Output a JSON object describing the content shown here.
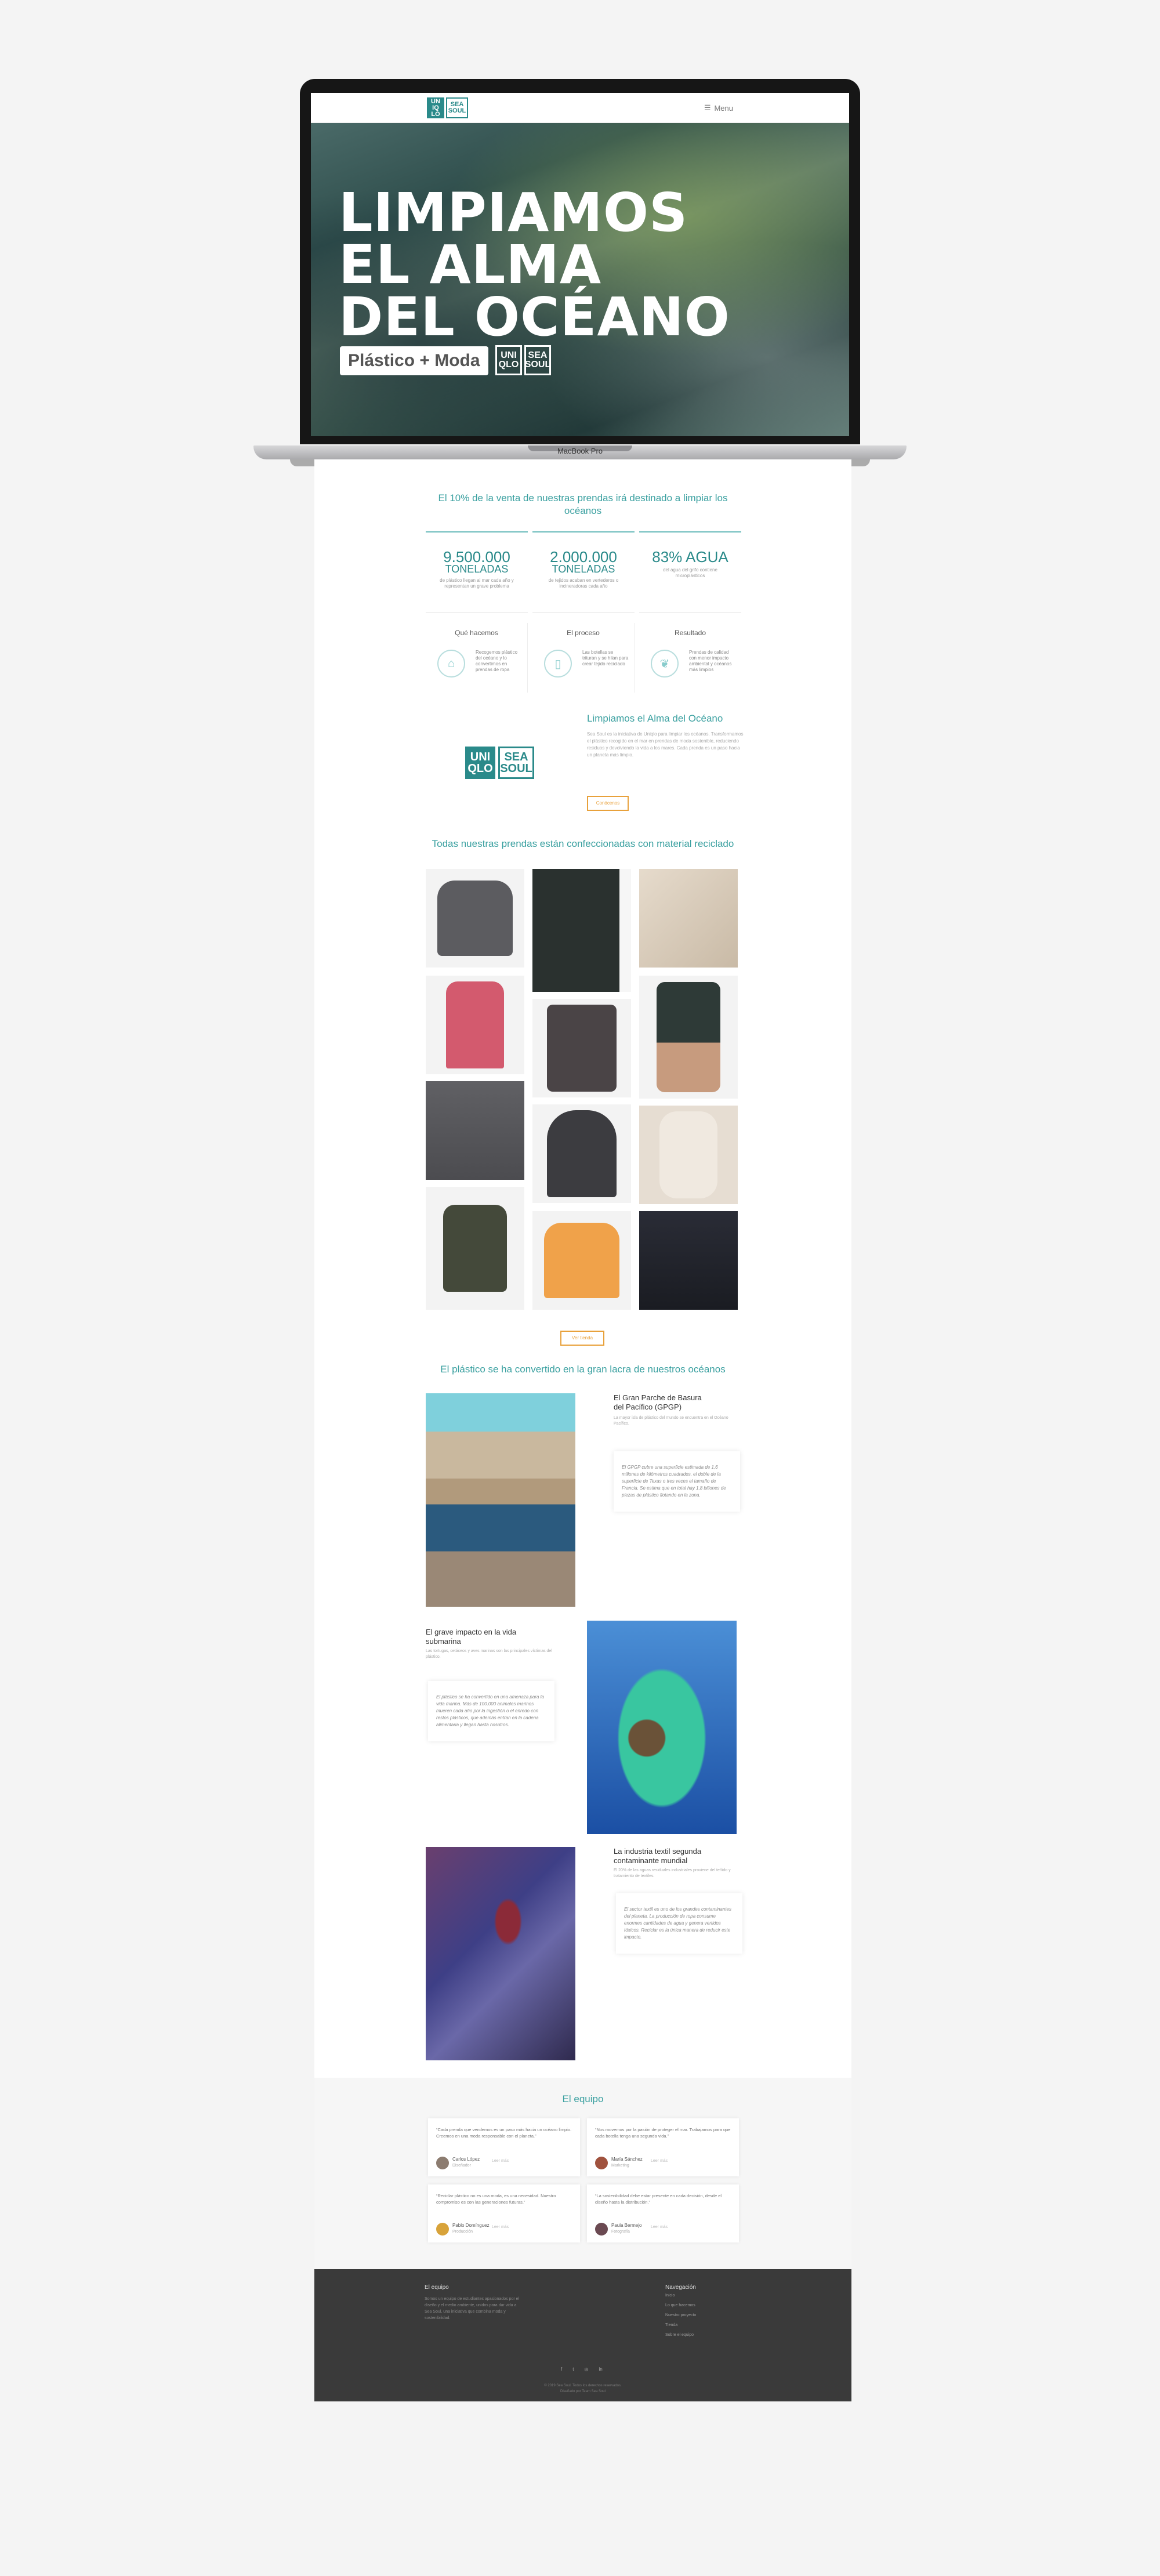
{
  "laptop": {
    "label": "MacBook Pro"
  },
  "header": {
    "logo": {
      "left": "UN\nIQ\nLO",
      "right": "SEA\nSOUL"
    },
    "menu_label": "Menu"
  },
  "hero": {
    "title": "LIMPIAMOS\nEL ALMA\nDEL OCÉANO",
    "pill": "Plástico + Moda",
    "logo_left": "UNI\nQLO",
    "logo_right": "SEA\nSOUL"
  },
  "intro": {
    "title": "El 10% de la venta de nuestras prendas irá destinado a limpiar los océanos"
  },
  "stats": [
    {
      "big": "9.500.000",
      "unit": "TONELADAS",
      "desc": "de plástico llegan al mar cada año y representan un grave problema"
    },
    {
      "big": "2.000.000",
      "unit": "TONELADAS",
      "desc": "de tejidos acaban en vertederos o incineradoras cada año"
    },
    {
      "big": "83% AGUA",
      "unit": "",
      "desc": "del agua del grifo contiene microplásticos"
    }
  ],
  "features": [
    {
      "title": "Qué hacemos",
      "icon": "shirt-icon",
      "desc": "Recogemos plástico del océano y lo convertimos en prendas de ropa"
    },
    {
      "title": "El proceso",
      "icon": "bottle-icon",
      "desc": "Las botellas se trituran y se hilan para crear tejido reciclado"
    },
    {
      "title": "Resultado",
      "icon": "leaf-icon",
      "desc": "Prendas de calidad con menor impacto ambiental y océanos más limpios"
    }
  ],
  "about": {
    "logo_left": "UNI\nQLO",
    "logo_right": "SEA\nSOUL",
    "title": "Limpiamos el Alma del Océano",
    "text": "Sea Soul es la iniciativa de Uniqlo para limpiar los océanos. Transformamos el plástico recogido en el mar en prendas de moda sostenible, reduciendo residuos y devolviendo la vida a los mares. Cada prenda es un paso hacia un planeta más limpio.",
    "button": "Conócenos"
  },
  "catalog": {
    "title": "Todas nuestras prendas están confeccionadas con material reciclado",
    "button": "Ver tienda"
  },
  "plastic": {
    "title": "El plástico se ha convertido en la gran lacra de nuestros océanos"
  },
  "articles": [
    {
      "title": "El Gran Parche de Basura del Pacífico (GPGP)",
      "sub": "La mayor isla de plástico del mundo se encuentra en el Océano Pacífico.",
      "quote": "El GPGP cubre una superficie estimada de 1,6 millones de kilómetros cuadrados, el doble de la superficie de Texas o tres veces el tamaño de Francia. Se estima que en total hay 1,8 billones de piezas de plástico flotando en la zona."
    },
    {
      "title": "El grave impacto en la vida submarina",
      "sub": "Las tortugas, cetáceos y aves marinas son las principales víctimas del plástico.",
      "quote": "El plástico se ha convertido en una amenaza para la vida marina. Más de 100.000 animales marinos mueren cada año por la ingestión o el enredo con restos plásticos, que además entran en la cadena alimentaria y llegan hasta nosotros."
    },
    {
      "title": "La industria textil segunda contaminante mundial",
      "sub": "El 20% de las aguas residuales industriales proviene del teñido y tratamiento de textiles.",
      "quote": "El sector textil es uno de los grandes contaminantes del planeta. La producción de ropa consume enormes cantidades de agua y genera vertidos tóxicos. Reciclar es la única manera de reducir este impacto."
    }
  ],
  "team": {
    "title": "El equipo",
    "members": [
      {
        "quote": "“Cada prenda que vendemos es un paso más hacia un océano limpio. Creemos en una moda responsable con el planeta.”",
        "name": "Carlos López",
        "role": "Diseñador",
        "link": "Leer más"
      },
      {
        "quote": "“Nos movemos por la pasión de proteger el mar. Trabajamos para que cada botella tenga una segunda vida.”",
        "name": "María Sánchez",
        "role": "Marketing",
        "link": "Leer más"
      },
      {
        "quote": "“Reciclar plástico no es una moda, es una necesidad. Nuestro compromiso es con las generaciones futuras.”",
        "name": "Pablo Domínguez",
        "role": "Producción",
        "link": "Leer más"
      },
      {
        "quote": "“La sostenibilidad debe estar presente en cada decisión, desde el diseño hasta la distribución.”",
        "name": "Paula Bermejo",
        "role": "Fotografía",
        "link": "Leer más"
      }
    ]
  },
  "footer": {
    "about_title": "El equipo",
    "about_text": "Somos un equipo de estudiantes apasionados por el diseño y el medio ambiente, unidos para dar vida a Sea Soul, una iniciativa que combina moda y sostenibilidad.",
    "nav_title": "Navegación",
    "nav": [
      "Inicio",
      "Lo que hacemos",
      "Nuestro proyecto",
      "Tienda",
      "Sobre el equipo"
    ],
    "social": [
      "f",
      "t",
      "◎",
      "in"
    ],
    "copyright": "© 2019 Sea Soul. Todos los derechos reservados.",
    "credit": "Diseñado por Team Sea Soul"
  }
}
